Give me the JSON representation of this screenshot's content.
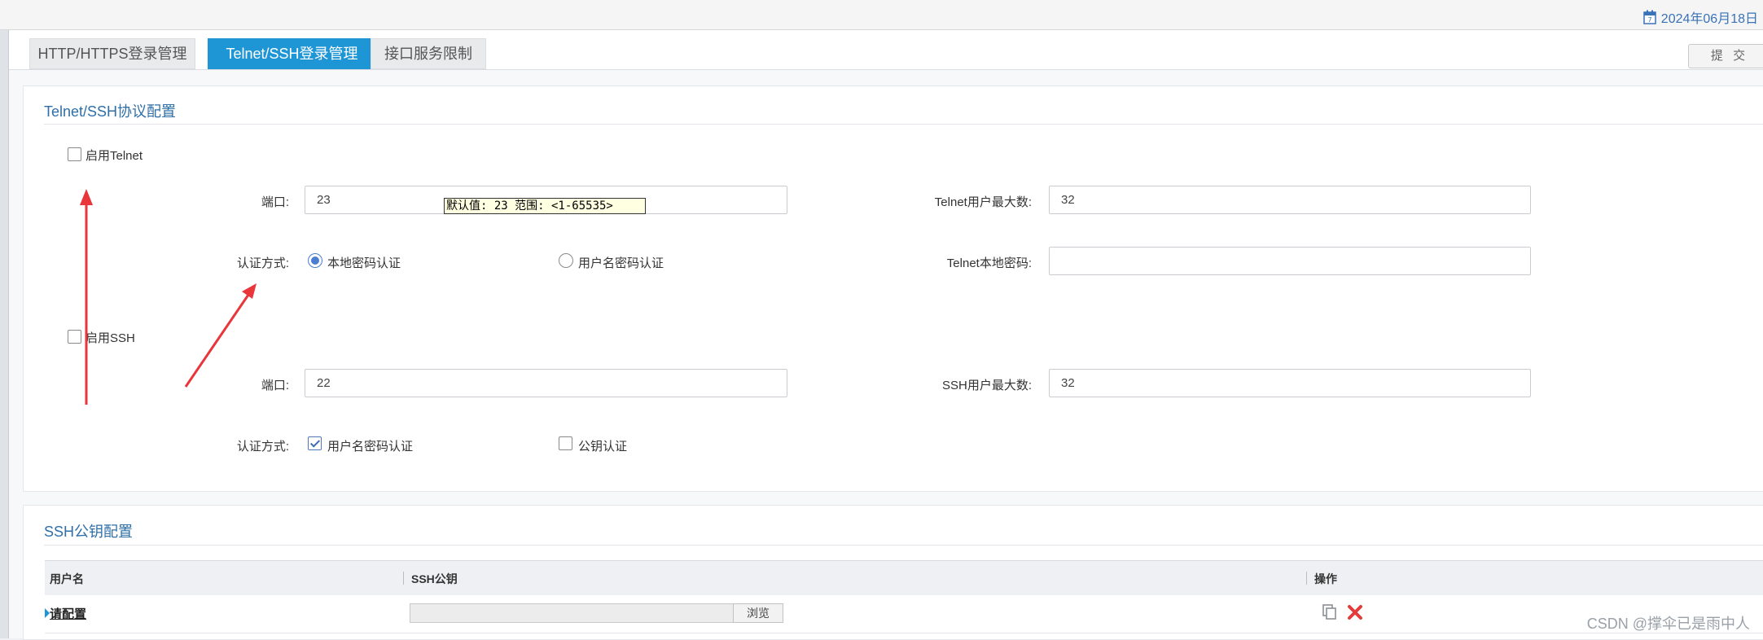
{
  "header": {
    "date": "2024年06月18日",
    "calendar_icon": "calendar-icon"
  },
  "tabs": [
    {
      "label": "HTTP/HTTPS登录管理",
      "active": false
    },
    {
      "label": "Telnet/SSH登录管理",
      "active": true
    },
    {
      "label": "接口服务限制",
      "active": false
    }
  ],
  "submit_label": "提 交",
  "protocol": {
    "title": "Telnet/SSH协议配置",
    "telnet": {
      "enable_label": "启用Telnet",
      "enabled": false,
      "port_label": "端口:",
      "port_value": "23",
      "port_tooltip": "默认值: 23 范围: <1-65535>",
      "auth_label": "认证方式:",
      "auth_local_label": "本地密码认证",
      "auth_local_checked": true,
      "auth_user_label": "用户名密码认证",
      "auth_user_checked": false,
      "max_users_label": "Telnet用户最大数:",
      "max_users_value": "32",
      "local_password_label": "Telnet本地密码:",
      "local_password_value": ""
    },
    "ssh": {
      "enable_label": "启用SSH",
      "enabled": false,
      "port_label": "端口:",
      "port_value": "22",
      "auth_label": "认证方式:",
      "auth_user_label": "用户名密码认证",
      "auth_user_checked": true,
      "auth_key_label": "公钥认证",
      "auth_key_checked": false,
      "max_users_label": "SSH用户最大数:",
      "max_users_value": "32"
    }
  },
  "pubkey": {
    "title": "SSH公钥配置",
    "columns": [
      "用户名",
      "SSH公钥",
      "操作"
    ],
    "rows": [
      {
        "username_link": "请配置",
        "browse_label": "浏览"
      }
    ]
  },
  "annotation_color": "#e8363a",
  "watermark": "CSDN @撑伞已是雨中人"
}
